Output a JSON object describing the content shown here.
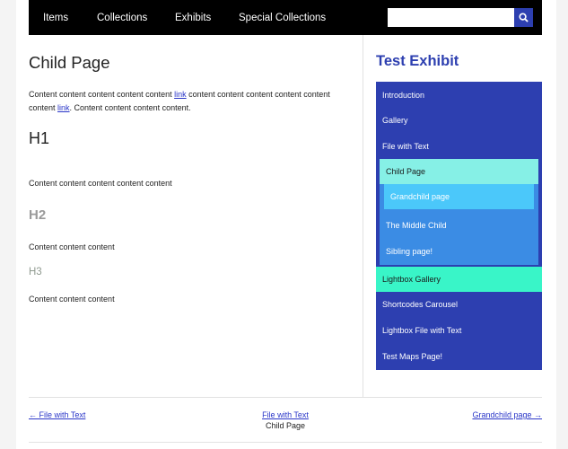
{
  "nav": {
    "items": [
      "Items",
      "Collections",
      "Exhibits",
      "Special Collections"
    ],
    "search_placeholder": ""
  },
  "main": {
    "title": "Child Page",
    "para": {
      "t1": "Content content content content content ",
      "link1": "link",
      "t2": " content content content content content content ",
      "link2": "link",
      "t3": ". Content content content content."
    },
    "h1": "H1",
    "text1": "Content content content content content",
    "h2": "H2",
    "text2": "Content content content",
    "h3": "H3",
    "text3": "Content content content"
  },
  "sidebar": {
    "title": "Test Exhibit",
    "items_top": [
      "Introduction",
      "Gallery",
      "File with Text"
    ],
    "child": "Child Page",
    "grandchild": "Grandchild page",
    "sub_items": [
      "The Middle Child",
      "Sibling page!"
    ],
    "items_bottom": [
      "Lightbox Gallery",
      "Shortcodes Carousel",
      "Lightbox File with Text",
      "Test Maps Page!"
    ]
  },
  "pagination": {
    "prev": "← File with Text",
    "up": "File with Text",
    "current": "Child Page",
    "next": "Grandchild page →"
  },
  "colors": {
    "nav_bg": "#000000",
    "accent": "#2d3fb0",
    "child_bg": "#86f0e6",
    "grandchild_bg": "#4bc8fa",
    "lightbox_bg": "#39f5c8",
    "link": "#2a36c8"
  }
}
